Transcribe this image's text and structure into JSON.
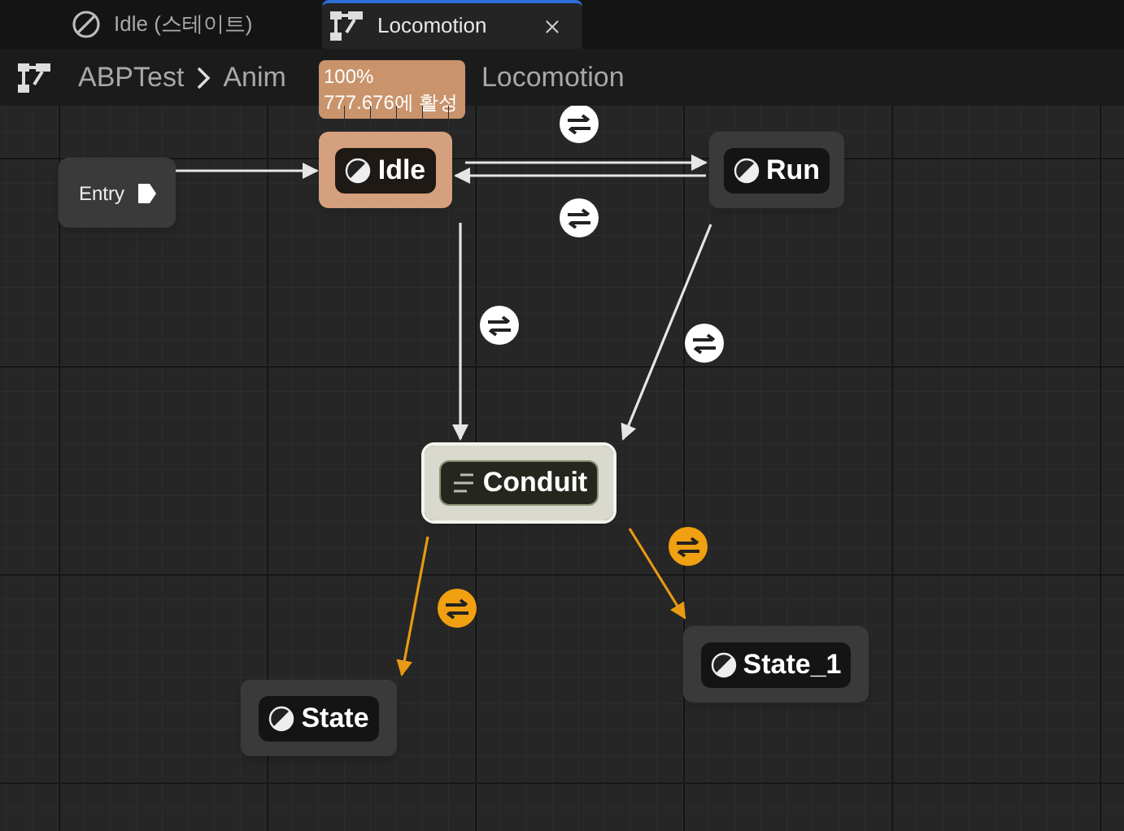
{
  "tabs": [
    {
      "label": "Idle (스테이트)",
      "kind": "state",
      "selected": false
    },
    {
      "label": "Locomotion",
      "kind": "graph",
      "selected": true
    }
  ],
  "breadcrumb": [
    "ABPTest",
    "Anim",
    "Locomotion"
  ],
  "tooltip": {
    "lines": [
      "100%",
      "777.676에 활성"
    ]
  },
  "nodes": [
    {
      "label": "Entry",
      "kind": "entry",
      "active": false,
      "selected": false
    },
    {
      "label": "Idle",
      "kind": "state",
      "active": true,
      "selected": false
    },
    {
      "label": "Run",
      "kind": "state",
      "active": false,
      "selected": false
    },
    {
      "label": "Conduit",
      "kind": "conduit",
      "active": false,
      "selected": true
    },
    {
      "label": "State",
      "kind": "state",
      "active": false,
      "selected": false
    },
    {
      "label": "State_1",
      "kind": "state",
      "active": false,
      "selected": false
    }
  ],
  "transitions": [
    {
      "color": "#ffffff"
    },
    {
      "color": "#ffffff"
    },
    {
      "color": "#ffffff"
    },
    {
      "color": "#ffffff"
    },
    {
      "color": "#f0a010"
    },
    {
      "color": "#f0a010"
    }
  ]
}
